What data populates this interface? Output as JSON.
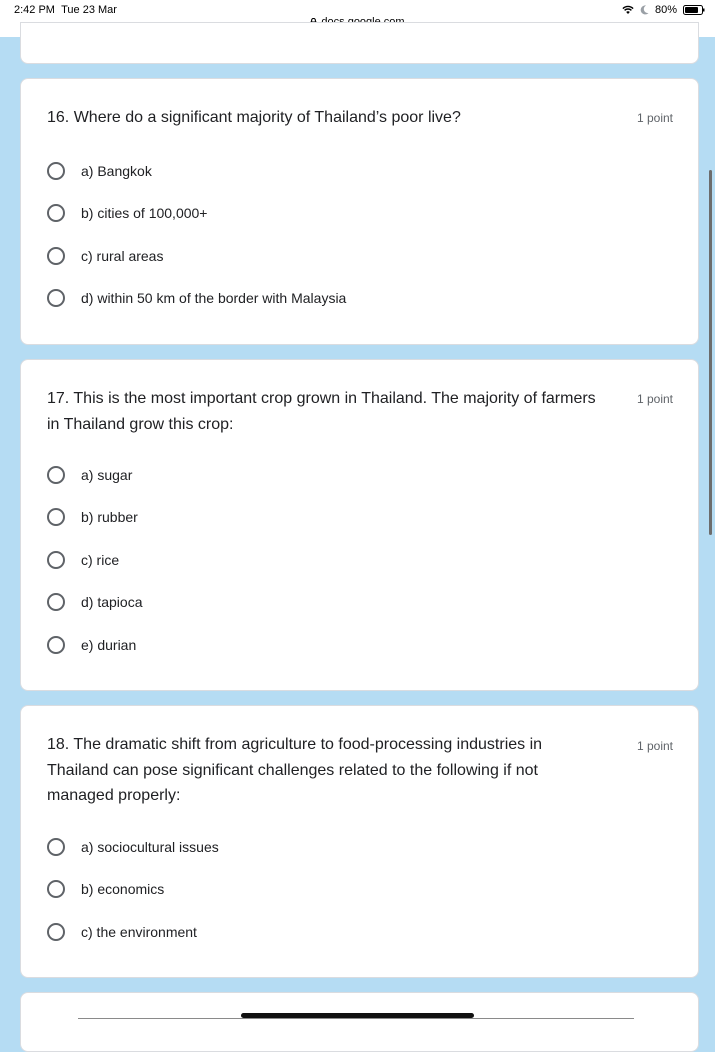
{
  "status": {
    "time": "2:42 PM",
    "date": "Tue 23 Mar",
    "battery": "80%"
  },
  "browser": {
    "url": "docs.google.com"
  },
  "questions": [
    {
      "title": "16. Where do a significant majority of Thailand’s poor live?",
      "points": "1 point",
      "options": [
        "a) Bangkok",
        "b) cities of 100,000+",
        "c) rural areas",
        "d) within 50 km of the border with Malaysia"
      ]
    },
    {
      "title": "17. This is the most important crop grown in Thailand. The majority of farmers in Thailand grow this crop:",
      "points": "1 point",
      "options": [
        "a) sugar",
        "b) rubber",
        "c) rice",
        "d) tapioca",
        "e) durian"
      ]
    },
    {
      "title": "18. The dramatic shift from agriculture to food-processing industries in Thailand can pose significant challenges related to the following if not managed properly:",
      "points": "1 point",
      "options": [
        "a) sociocultural issues",
        "b) economics",
        "c) the environment"
      ]
    }
  ]
}
